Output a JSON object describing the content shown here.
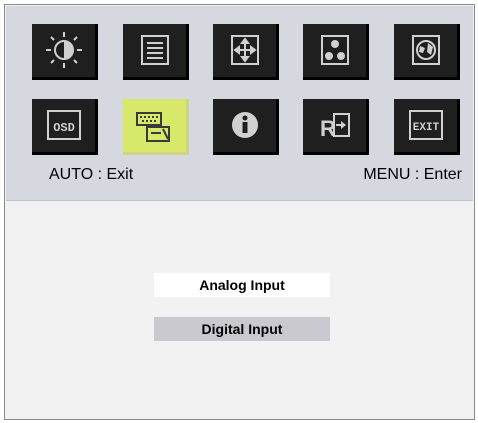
{
  "menu": {
    "row1": [
      {
        "icon": "brightness-icon",
        "name": "Brightness"
      },
      {
        "icon": "image-settings-icon",
        "name": "Image"
      },
      {
        "icon": "position-icon",
        "name": "Position"
      },
      {
        "icon": "color-icon",
        "name": "Color"
      },
      {
        "icon": "language-icon",
        "name": "Language"
      }
    ],
    "row2": [
      {
        "icon": "osd-icon",
        "name": "OSD",
        "text": "OSD"
      },
      {
        "icon": "input-select-icon",
        "name": "Input Select",
        "selected": true
      },
      {
        "icon": "information-icon",
        "name": "Information"
      },
      {
        "icon": "reset-icon",
        "name": "Reset"
      },
      {
        "icon": "exit-icon",
        "name": "Exit",
        "text": "EXIT"
      }
    ]
  },
  "hints": {
    "left": "AUTO : Exit",
    "right": "MENU : Enter"
  },
  "submenu": {
    "options": [
      {
        "label": "Analog Input",
        "highlighted": false
      },
      {
        "label": "Digital Input",
        "highlighted": true
      }
    ]
  },
  "colors": {
    "top_panel": "#d6d8e0",
    "tile": "#1f1f1f",
    "tile_selected": "#d8e86a",
    "bottom_panel": "#f2f2f2",
    "option_highlight": "#c9c9cf"
  }
}
